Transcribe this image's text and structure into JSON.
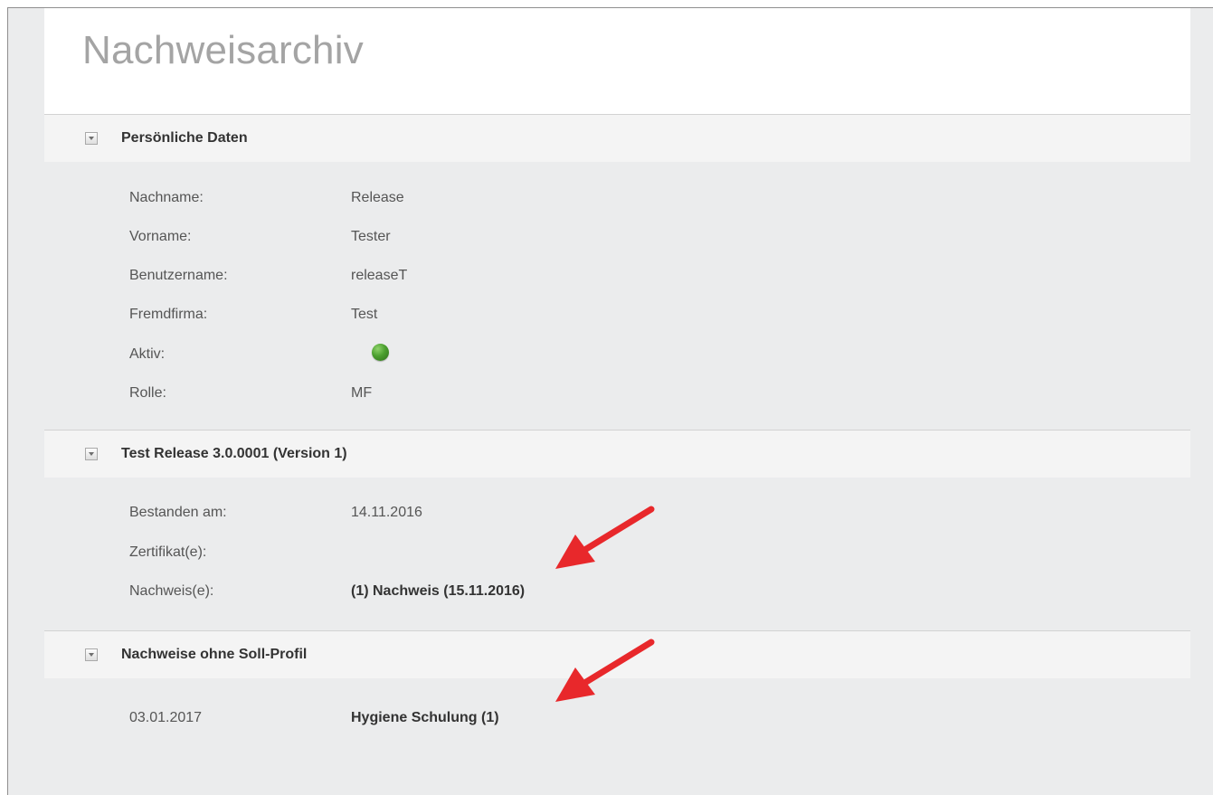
{
  "page": {
    "title": "Nachweisarchiv"
  },
  "sections": {
    "personal": {
      "header": "Persönliche Daten",
      "rows": [
        {
          "label": "Nachname:",
          "value": "Release"
        },
        {
          "label": "Vorname:",
          "value": "Tester"
        },
        {
          "label": "Benutzername:",
          "value": "releaseT"
        },
        {
          "label": "Fremdfirma:",
          "value": "Test"
        },
        {
          "label": "Aktiv:",
          "value_icon": "green-status-dot",
          "status_color": "#4b9f2f"
        },
        {
          "label": "Rolle:",
          "value": "MF"
        }
      ]
    },
    "test_release": {
      "header": "Test Release 3.0.0001 (Version 1)",
      "rows": [
        {
          "label": "Bestanden am:",
          "value": "14.11.2016"
        },
        {
          "label": "Zertifikat(e):",
          "value": ""
        },
        {
          "label": "Nachweis(e):",
          "value": "(1) Nachweis (15.11.2016)"
        }
      ]
    },
    "without_profile": {
      "header": "Nachweise ohne Soll-Profil",
      "rows": [
        {
          "label": "03.01.2017",
          "value": "Hygiene Schulung (1)"
        }
      ]
    }
  },
  "annotations": {
    "arrow_color": "#e8282b",
    "arrow_icon": "red-arrow-icon"
  }
}
